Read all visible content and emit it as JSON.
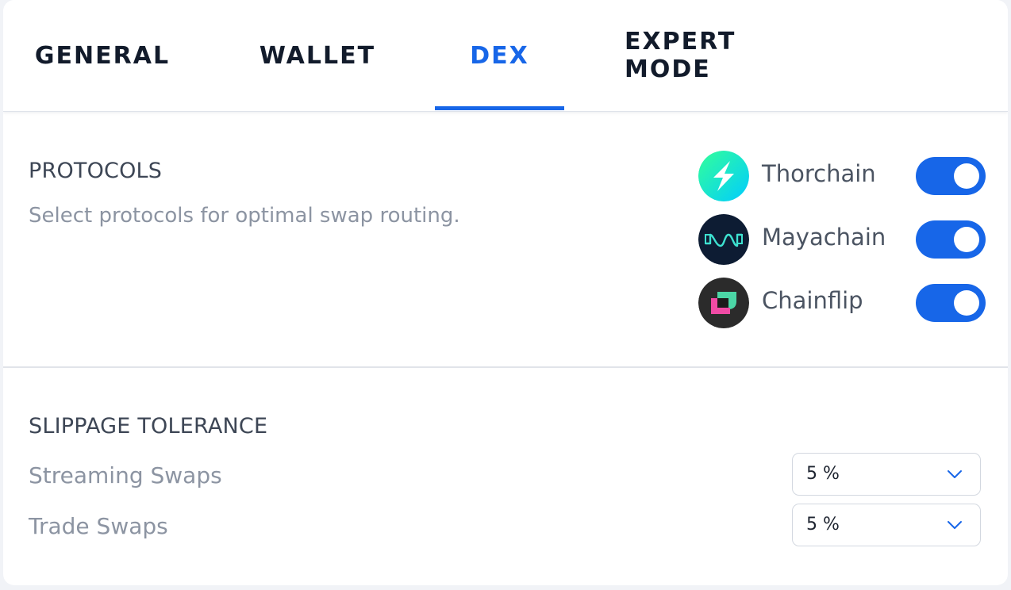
{
  "tabs": [
    {
      "label": "GENERAL",
      "active": false
    },
    {
      "label": "WALLET",
      "active": false
    },
    {
      "label": "DEX",
      "active": true
    },
    {
      "label": "EXPERT MODE",
      "active": false
    }
  ],
  "protocols": {
    "title": "PROTOCOLS",
    "description": "Select protocols for optimal swap routing.",
    "items": [
      {
        "name": "Thorchain",
        "icon": "thorchain-logo-icon",
        "enabled": true
      },
      {
        "name": "Mayachain",
        "icon": "mayachain-logo-icon",
        "enabled": true
      },
      {
        "name": "Chainflip",
        "icon": "chainflip-logo-icon",
        "enabled": true
      }
    ]
  },
  "slippage": {
    "title": "SLIPPAGE TOLERANCE",
    "rows": [
      {
        "label": "Streaming Swaps",
        "value": "5 %"
      },
      {
        "label": "Trade Swaps",
        "value": "5 %"
      }
    ]
  },
  "colors": {
    "accent": "#1766e8",
    "text_dark": "#121b2b",
    "text_muted": "#8c94a2"
  }
}
